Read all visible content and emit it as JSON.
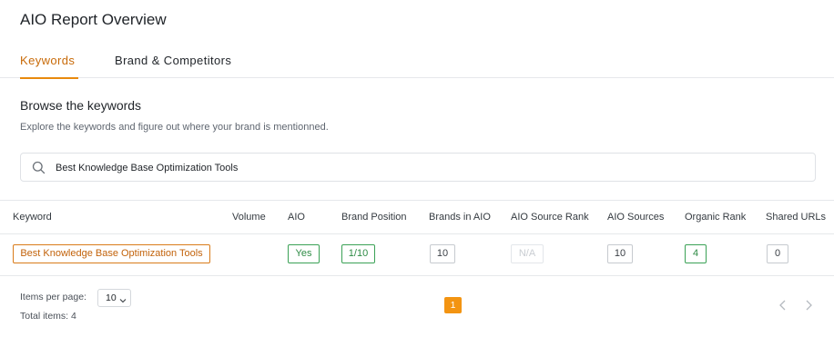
{
  "page": {
    "title": "AIO Report Overview"
  },
  "tabs": [
    {
      "label": "Keywords",
      "active": true
    },
    {
      "label": "Brand & Competitors",
      "active": false
    }
  ],
  "browse": {
    "title": "Browse the keywords",
    "description": "Explore the keywords and figure out where your brand is mentionned."
  },
  "search": {
    "value": "Best Knowledge Base Optimization Tools",
    "icon": "search-icon"
  },
  "table": {
    "columns": [
      "Keyword",
      "Volume",
      "AIO",
      "Brand Position",
      "Brands in AIO",
      "AIO Source Rank",
      "AIO Sources",
      "Organic Rank",
      "Shared URLs"
    ],
    "rows": [
      {
        "keyword": "Best Knowledge Base Optimization Tools",
        "volume": "",
        "aio": "Yes",
        "brand_position": "1/10",
        "brands_in_aio": "10",
        "aio_source_rank": "N/A",
        "aio_sources": "10",
        "organic_rank": "4",
        "shared_urls": "0"
      }
    ]
  },
  "pagination": {
    "items_per_page_label": "Items per page:",
    "items_per_page_value": "10",
    "total_items_label": "Total items: 4",
    "current_page": "1"
  },
  "colors": {
    "accent": "#e8890c",
    "active_page": "#f39412",
    "positive": "#3aa155",
    "neutral_border": "#c6cacf"
  }
}
